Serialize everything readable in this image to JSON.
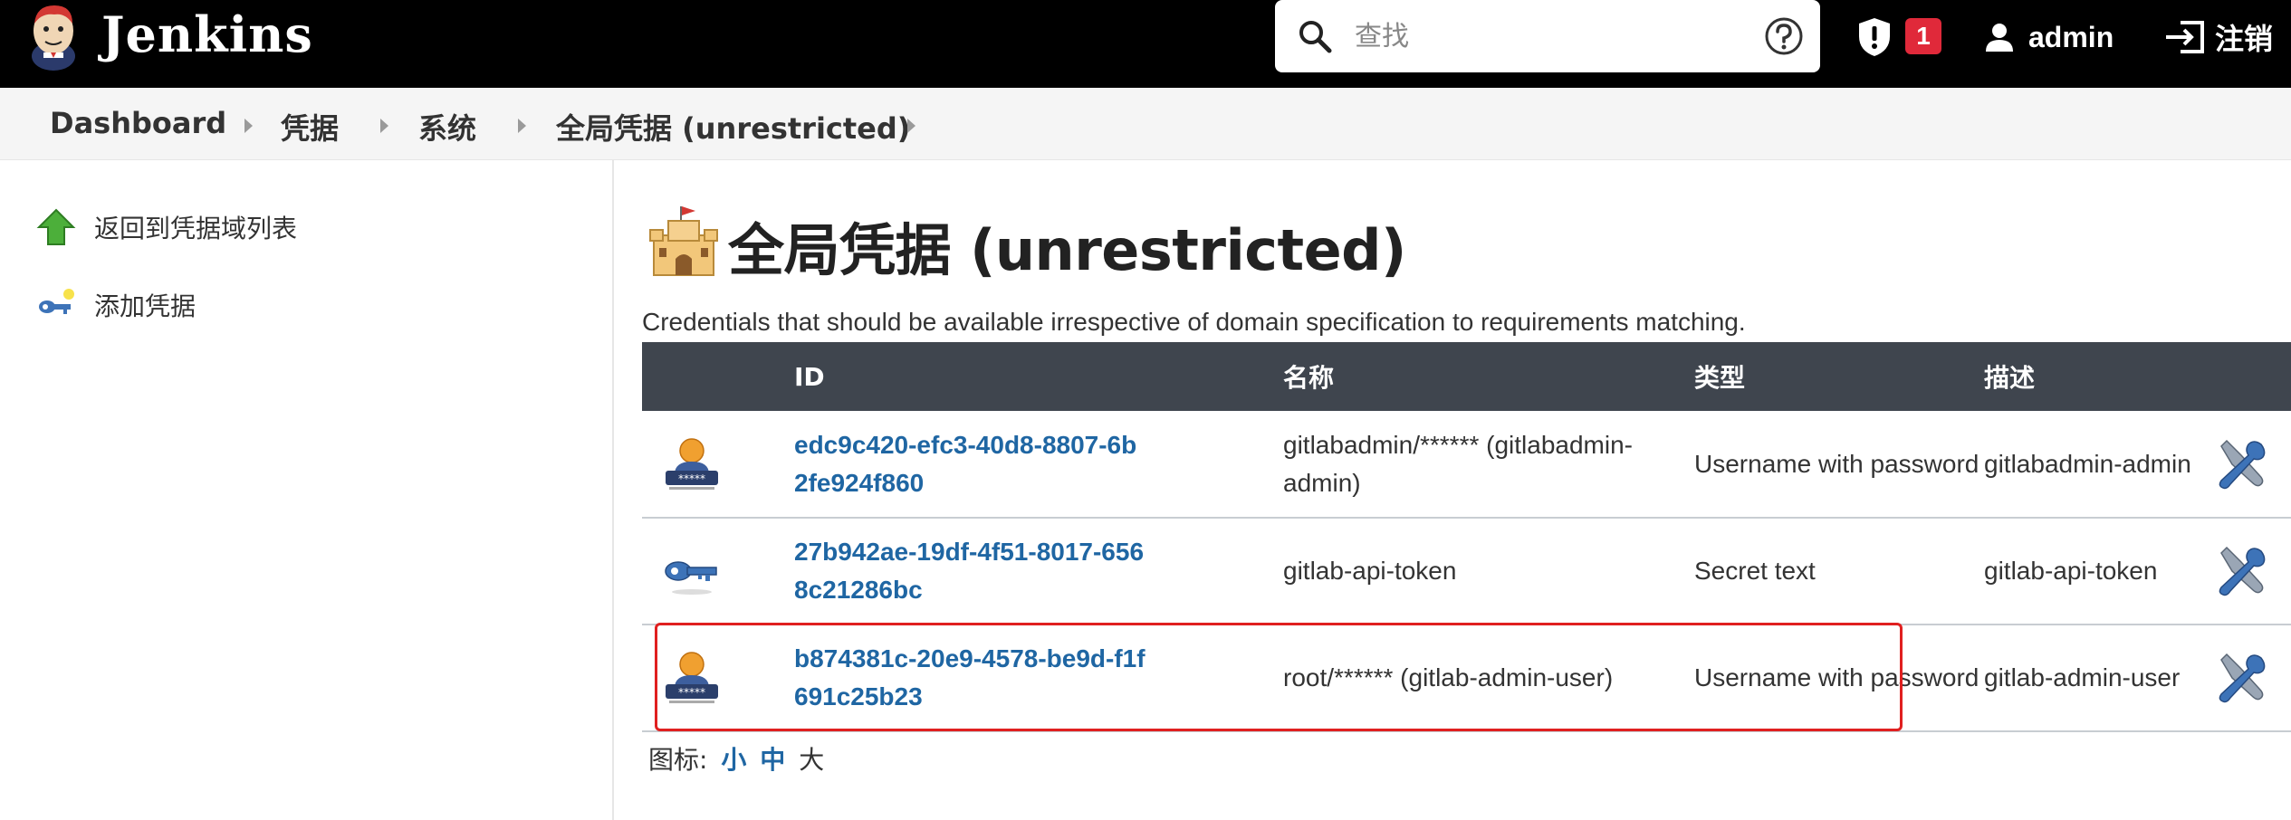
{
  "header": {
    "brand": "Jenkins",
    "search_placeholder": "查找",
    "alert_count": "1",
    "user_name": "admin",
    "logout_label": "注销"
  },
  "breadcrumb": [
    "Dashboard",
    "凭据",
    "系统",
    "全局凭据 (unrestricted)"
  ],
  "sidebar": {
    "items": [
      {
        "label": "返回到凭据域列表",
        "icon": "up-arrow-icon"
      },
      {
        "label": "添加凭据",
        "icon": "key-icon"
      }
    ]
  },
  "main": {
    "title": "全局凭据 (unrestricted)",
    "description": "Credentials that should be available irrespective of domain specification to requirements matching.",
    "table": {
      "headers": [
        "ID",
        "名称",
        "类型",
        "描述"
      ],
      "rows": [
        {
          "icon": "user-password-icon",
          "id": "edc9c420-efc3-40d8-8807-6b2fe924f860",
          "name": "gitlabadmin/****** (gitlabadmin-admin)",
          "type": "Username with password",
          "description": "gitlabadmin-admin"
        },
        {
          "icon": "secret-key-icon",
          "id": "27b942ae-19df-4f51-8017-6568c21286bc",
          "name": "gitlab-api-token",
          "type": "Secret text",
          "description": "gitlab-api-token"
        },
        {
          "icon": "user-password-icon",
          "id": "b874381c-20e9-4578-be9d-f1f691c25b23",
          "name": "root/****** (gitlab-admin-user)",
          "type": "Username with password",
          "description": "gitlab-admin-user"
        }
      ]
    },
    "icon_size": {
      "label": "图标:",
      "small": "小",
      "medium": "中",
      "large": "大"
    }
  },
  "colors": {
    "header_bg": "#000000",
    "table_header_bg": "#3f454e",
    "link": "#1f66a3",
    "badge": "#e0293a",
    "highlight": "#e02020"
  }
}
